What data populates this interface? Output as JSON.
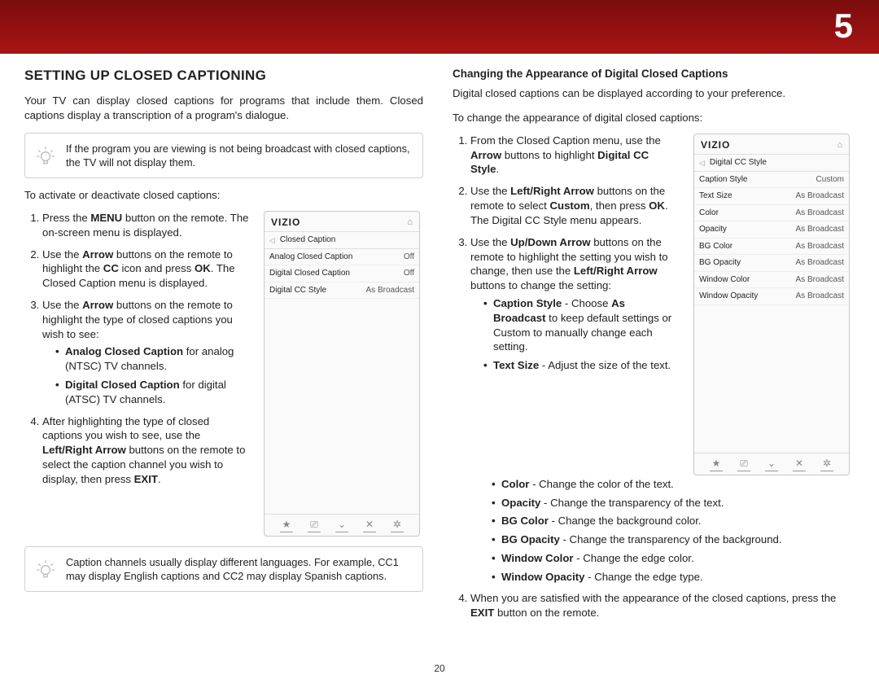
{
  "page_number_large": "5",
  "page_number_bottom": "20",
  "left": {
    "title": "SETTING UP CLOSED CAPTIONING",
    "intro": "Your TV can display closed captions for programs that include them. Closed captions display a transcription of a program's dialogue.",
    "tip1": "If the program you are viewing is not being broadcast with closed captions, the TV will not display them.",
    "activate_lead": "To activate or deactivate closed captions:",
    "steps": {
      "s1a": "Press the ",
      "s1b": "MENU",
      "s1c": " button on the remote. The on-screen menu is displayed.",
      "s2a": "Use the ",
      "s2b": "Arrow",
      "s2c": " buttons on the remote to highlight the ",
      "s2d": "CC",
      "s2e": " icon and press ",
      "s2f": "OK",
      "s2g": ". The Closed Caption menu is displayed.",
      "s3a": "Use the ",
      "s3b": "Arrow",
      "s3c": " buttons on the remote to highlight the type of closed captions you wish to see:",
      "b1a": "Analog Closed Caption",
      "b1b": " for analog (NTSC) TV channels.",
      "b2a": "Digital Closed Caption",
      "b2b": " for digital (ATSC) TV channels.",
      "s4a": "After highlighting the type of closed captions you wish to see, use the ",
      "s4b": "Left/Right Arrow",
      "s4c": " buttons on the remote to select the caption channel you wish to display, then press ",
      "s4d": "EXIT",
      "s4e": "."
    },
    "tip2": "Caption channels usually display different languages. For example, CC1 may display English captions and CC2 may display Spanish captions."
  },
  "menu1": {
    "brand": "VIZIO",
    "title": "Closed Caption",
    "rows": [
      {
        "lab": "Analog Closed Caption",
        "val": "Off"
      },
      {
        "lab": "Digital Closed Caption",
        "val": "Off"
      },
      {
        "lab": "Digital CC Style",
        "val": "As Broadcast"
      }
    ],
    "footer": [
      "★",
      "⎚",
      "⌄",
      "✕",
      "✲"
    ]
  },
  "right": {
    "subhead": "Changing the Appearance of Digital Closed Captions",
    "p1": "Digital closed captions can be displayed according to your preference.",
    "p2": "To change the appearance of digital closed captions:",
    "steps": {
      "s1a": "From the Closed Caption menu, use the ",
      "s1b": "Arrow",
      "s1c": " buttons to highlight ",
      "s1d": "Digital CC Style",
      "s1e": ".",
      "s2a": "Use the ",
      "s2b": "Left/Right Arrow",
      "s2c": " buttons on the remote to select ",
      "s2d": "Custom",
      "s2e": ", then press ",
      "s2f": "OK",
      "s2g": ". The Digital CC Style menu appears.",
      "s3a": "Use the ",
      "s3b": "Up/Down Arrow",
      "s3c": " buttons on the remote to highlight the setting you wish to change, then use the ",
      "s3d": "Left/Right Arrow",
      "s3e": " buttons to change the setting:",
      "b1a": "Caption Style",
      "b1b": " - Choose ",
      "b1c": "As Broadcast",
      "b1d": " to keep default settings or Custom to manually change each setting.",
      "b2a": "Text Size",
      "b2b": " - Adjust the size of the text.",
      "b3a": "Color",
      "b3b": " - Change the color of the text.",
      "b4a": "Opacity",
      "b4b": " - Change the transparency of the text.",
      "b5a": "BG Color",
      "b5b": " - Change the background color.",
      "b6a": "BG Opacity",
      "b6b": " - Change the transparency of the background.",
      "b7a": "Window Color",
      "b7b": " - Change the edge color.",
      "b8a": "Window Opacity",
      "b8b": " - Change the edge type.",
      "s4a": "When you are satisfied with the appearance of the closed captions, press the ",
      "s4b": "EXIT",
      "s4c": " button on the remote."
    }
  },
  "menu2": {
    "brand": "VIZIO",
    "title": "Digital CC Style",
    "rows": [
      {
        "lab": "Caption Style",
        "val": "Custom"
      },
      {
        "lab": "Text Size",
        "val": "As Broadcast"
      },
      {
        "lab": "Color",
        "val": "As Broadcast"
      },
      {
        "lab": "Opacity",
        "val": "As Broadcast"
      },
      {
        "lab": "BG Color",
        "val": "As Broadcast"
      },
      {
        "lab": "BG Opacity",
        "val": "As Broadcast"
      },
      {
        "lab": "Window Color",
        "val": "As Broadcast"
      },
      {
        "lab": "Window Opacity",
        "val": "As Broadcast"
      }
    ],
    "footer": [
      "★",
      "⎚",
      "⌄",
      "✕",
      "✲"
    ]
  }
}
